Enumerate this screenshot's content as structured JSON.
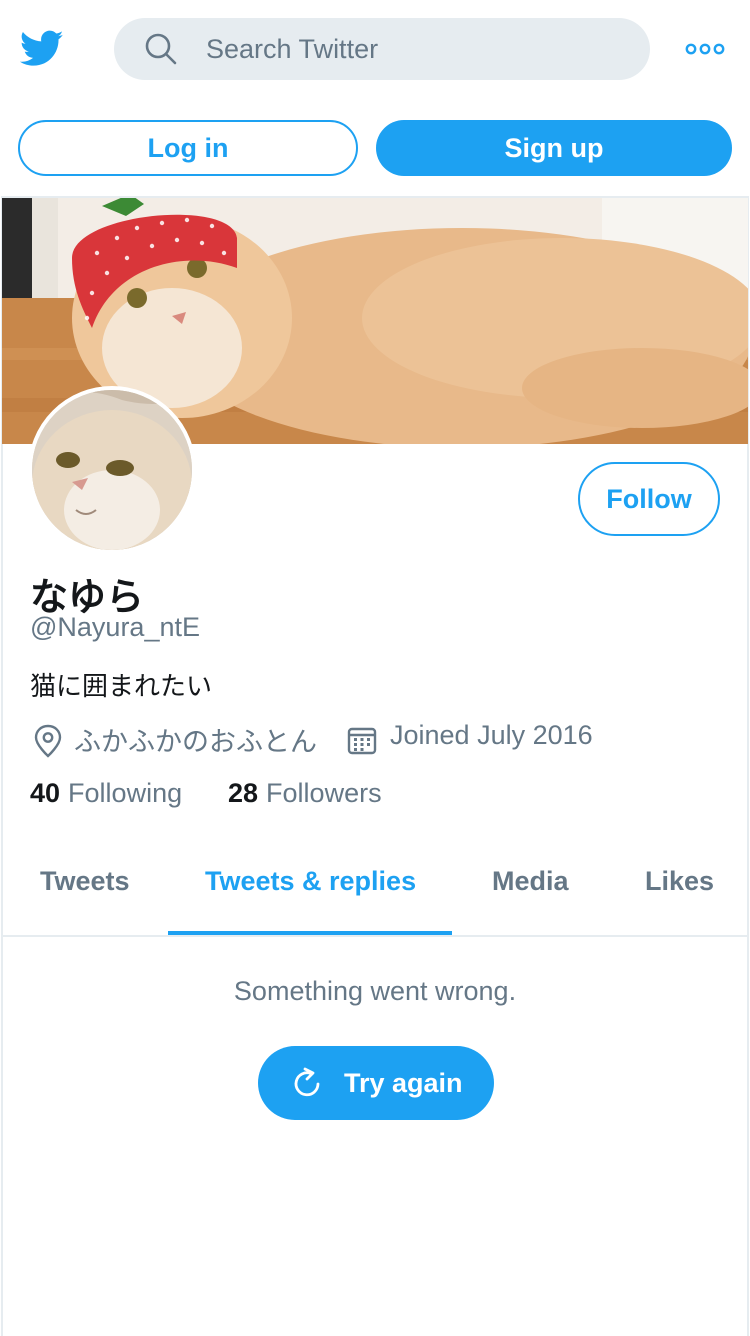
{
  "header": {
    "logo_icon": "twitter-bird-icon",
    "search": {
      "placeholder": "Search Twitter",
      "value": ""
    },
    "more_icon": "more-dots-icon"
  },
  "auth": {
    "login_label": "Log in",
    "signup_label": "Sign up"
  },
  "profile": {
    "banner_description": "",
    "display_name": "なゆら",
    "handle": "@Nayura_ntE",
    "bio": "猫に囲まれたい",
    "location": "ふかふかのおふとん",
    "joined": "Joined July 2016",
    "following_count": "40",
    "following_label": "Following",
    "followers_count": "28",
    "followers_label": "Followers",
    "follow_label": "Follow"
  },
  "tabs": [
    {
      "label": "Tweets",
      "active": false
    },
    {
      "label": "Tweets & replies",
      "active": true
    },
    {
      "label": "Media",
      "active": false
    },
    {
      "label": "Likes",
      "active": false
    }
  ],
  "timeline": {
    "error_message": "Something went wrong.",
    "retry_label": "Try again"
  },
  "colors": {
    "accent": "#1da1f2",
    "secondary_text": "#657786",
    "search_bg": "#e6ecf0"
  }
}
